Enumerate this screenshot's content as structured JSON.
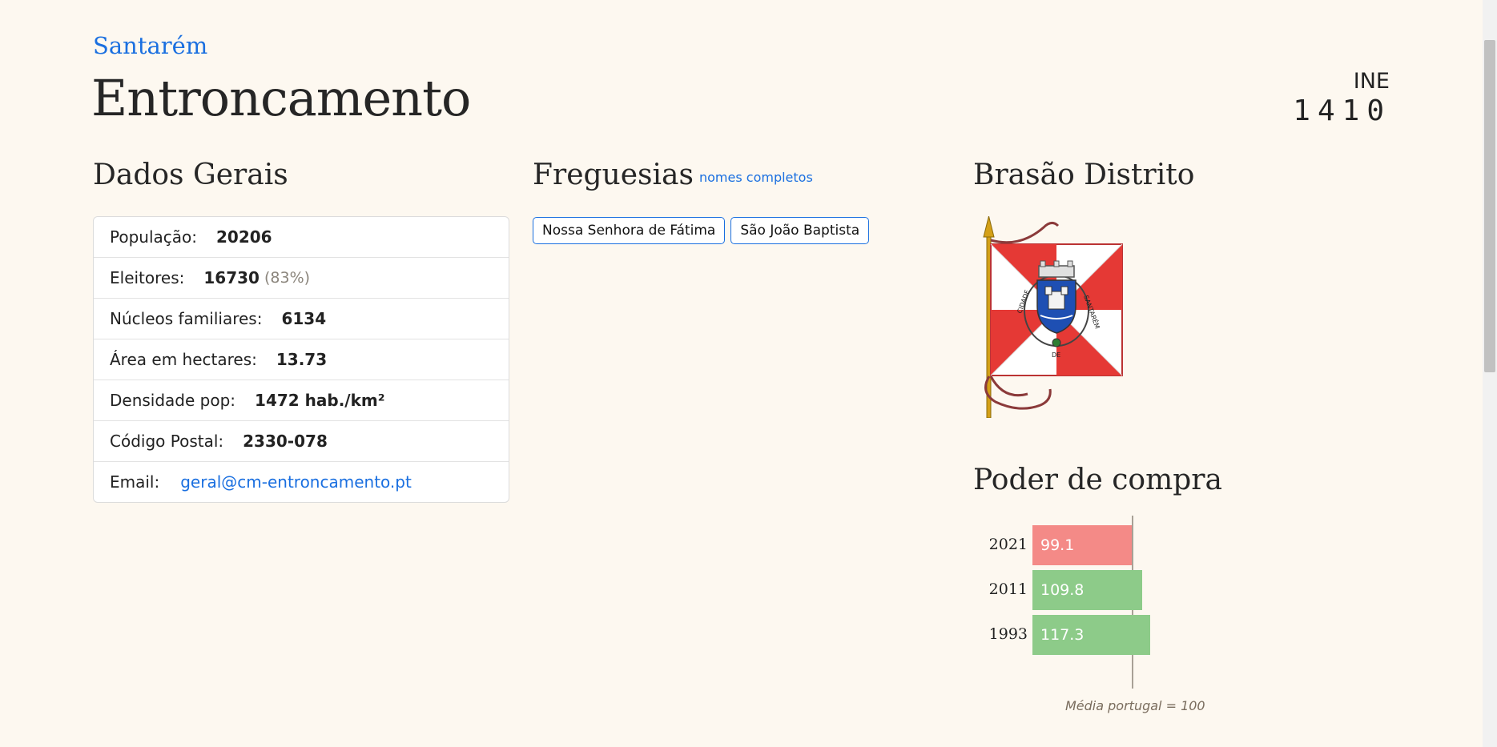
{
  "header": {
    "district": "Santarém",
    "municipality": "Entroncamento",
    "ine_label": "INE",
    "ine_code": "1410"
  },
  "dados_gerais": {
    "title": "Dados Gerais",
    "rows": [
      {
        "label": "População:",
        "value": "20206"
      },
      {
        "label": "Eleitores:",
        "value": "16730",
        "extra": "(83%)"
      },
      {
        "label": "Núcleos familiares:",
        "value": "6134"
      },
      {
        "label": "Área em hectares:",
        "value": "13.73"
      },
      {
        "label": "Densidade pop:",
        "value": "1472 hab./km²"
      },
      {
        "label": "Código Postal:",
        "value": "2330-078"
      },
      {
        "label": "Email:",
        "value": "geral@cm-entroncamento.pt"
      }
    ]
  },
  "freguesias": {
    "title": "Freguesias",
    "full_names_link": "nomes completos",
    "items": [
      "Nossa Senhora de Fátima",
      "São João Baptista"
    ]
  },
  "brasao": {
    "title": "Brasão Distrito",
    "flag_text_left": "CIDADE",
    "flag_text_mid": "DE",
    "flag_text_right": "SANTARÉM",
    "colors": {
      "red": "#e53935",
      "white": "#ffffff",
      "pole": "#d4a017"
    }
  },
  "poder_compra": {
    "title": "Poder de compra",
    "note": "Média portugal = 100"
  },
  "chart_data": {
    "type": "bar",
    "orientation": "horizontal",
    "categories": [
      "2021",
      "2011",
      "1993"
    ],
    "values": [
      99.1,
      109.8,
      117.3
    ],
    "reference": 100,
    "colors": {
      "below": "#f48a87",
      "above": "#8dcb89"
    }
  }
}
